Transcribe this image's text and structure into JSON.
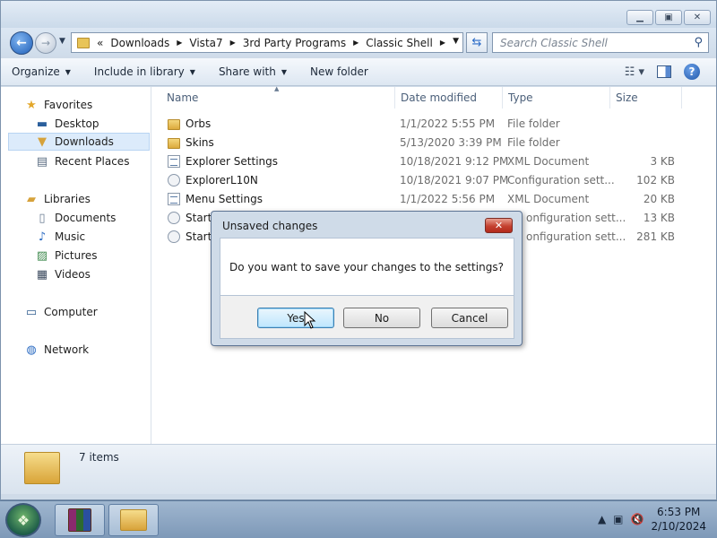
{
  "window": {
    "caption_buttons": [
      "minimize-icon",
      "maximize-icon",
      "close-icon"
    ]
  },
  "address": {
    "overflow": "«",
    "crumbs": [
      "Downloads",
      "Vista7",
      "3rd Party Programs",
      "Classic Shell"
    ],
    "search_placeholder": "Search Classic Shell"
  },
  "toolbar": {
    "organize": "Organize",
    "include_in_library": "Include in library",
    "share_with": "Share with",
    "new_folder": "New folder"
  },
  "navpane": {
    "favorites": "Favorites",
    "desktop": "Desktop",
    "downloads": "Downloads",
    "recent_places": "Recent Places",
    "libraries": "Libraries",
    "documents": "Documents",
    "music": "Music",
    "pictures": "Pictures",
    "videos": "Videos",
    "computer": "Computer",
    "network": "Network"
  },
  "columns": {
    "name": "Name",
    "date_modified": "Date modified",
    "type": "Type",
    "size": "Size"
  },
  "files": [
    {
      "name": "Orbs",
      "date": "1/1/2022 5:55 PM",
      "type": "File folder",
      "size": "",
      "icon": "folder-icon"
    },
    {
      "name": "Skins",
      "date": "5/13/2020 3:39 PM",
      "type": "File folder",
      "size": "",
      "icon": "folder-icon"
    },
    {
      "name": "Explorer Settings",
      "date": "10/18/2021 9:12 PM",
      "type": "XML Document",
      "size": "3 KB",
      "icon": "xml-file-icon"
    },
    {
      "name": "ExplorerL10N",
      "date": "10/18/2021 9:07 PM",
      "type": "Configuration sett...",
      "size": "102 KB",
      "icon": "config-file-icon"
    },
    {
      "name": "Menu Settings",
      "date": "1/1/2022 5:56 PM",
      "type": "XML Document",
      "size": "20 KB",
      "icon": "xml-file-icon"
    },
    {
      "name": "StartM",
      "date": "",
      "type": "onfiguration sett...",
      "size": "13 KB",
      "icon": "config-file-icon"
    },
    {
      "name": "StartM",
      "date": "",
      "type": "onfiguration sett...",
      "size": "281 KB",
      "icon": "config-file-icon"
    }
  ],
  "details": {
    "items_count": "7 items"
  },
  "dialog": {
    "title": "Unsaved changes",
    "message": "Do you want to save your changes to the settings?",
    "yes": "Yes",
    "no": "No",
    "cancel": "Cancel"
  },
  "taskbar": {
    "time": "6:53 PM",
    "date": "2/10/2024"
  }
}
